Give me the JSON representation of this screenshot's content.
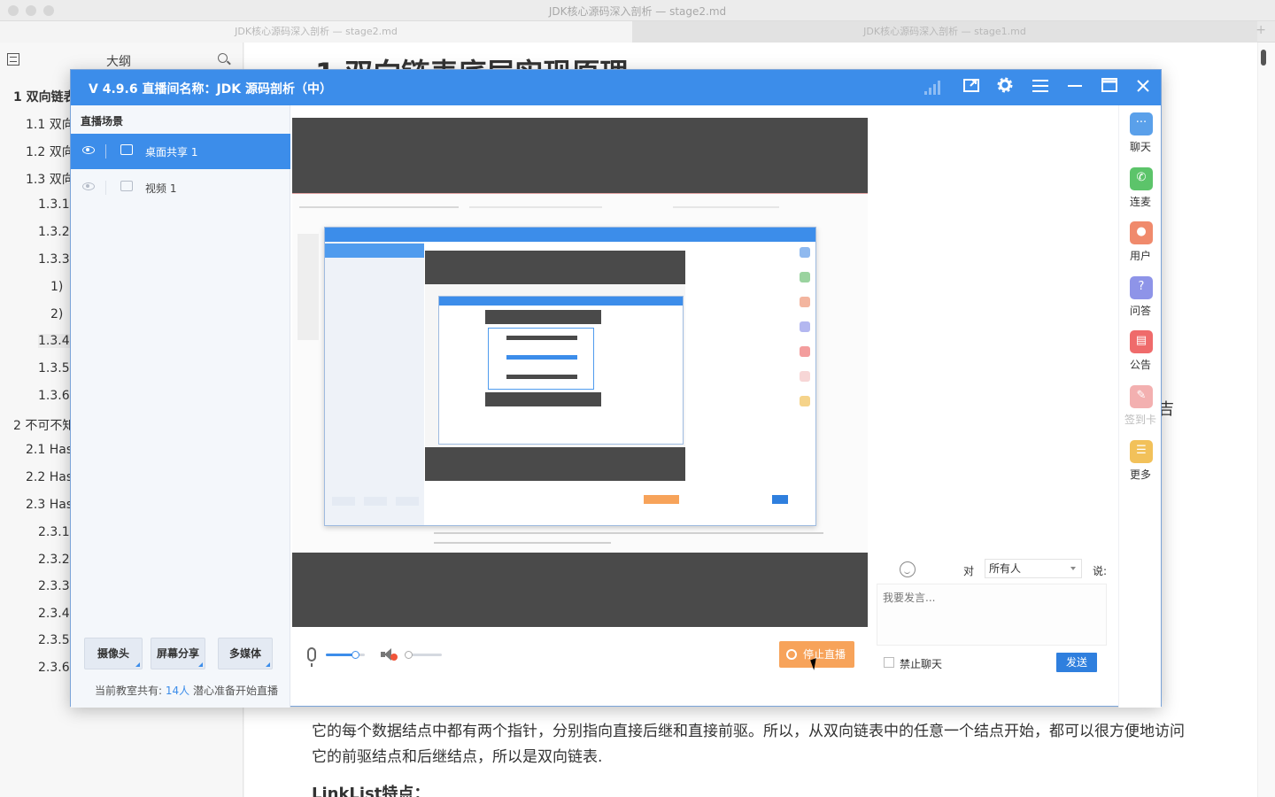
{
  "editor": {
    "window_title": "JDK核心源码深入剖析 — stage2.md",
    "tabs": [
      {
        "label": "JDK核心源码深入剖析 — stage2.md"
      },
      {
        "label": "JDK核心源码深入剖析 — stage1.md"
      }
    ],
    "outline_title": "大纲",
    "outline_items": [
      {
        "label": "1 双向链表"
      },
      {
        "label": "1.1 双向"
      },
      {
        "label": "1.2 双向"
      },
      {
        "label": "1.3 双向"
      },
      {
        "label": "1.3.1"
      },
      {
        "label": "1.3.2"
      },
      {
        "label": "1.3.3"
      },
      {
        "label": "1)"
      },
      {
        "label": "2)"
      },
      {
        "label": "1.3.4"
      },
      {
        "label": "1.3.5"
      },
      {
        "label": "1.3.6"
      },
      {
        "label": "2 不可不知"
      },
      {
        "label": "2.1 Has"
      },
      {
        "label": "2.2 Has"
      },
      {
        "label": "2.3 Has"
      },
      {
        "label": "2.3.1"
      },
      {
        "label": "2.3.2"
      },
      {
        "label": "2.3.3"
      },
      {
        "label": "2.3.4"
      },
      {
        "label": "2.3.5"
      },
      {
        "label": "2.3.6"
      }
    ],
    "heading": "1 双向链表底层实现原理",
    "paragraph": "它的每个数据结点中都有两个指针，分别指向直接后继和直接前驱。所以，从双向链表中的任意一个结点开始，都可以很方便地访问它的前驱结点和后继结点，所以是双向链表.",
    "subheading": "LinkList特点：",
    "edge_fragment": "吉"
  },
  "live": {
    "title": "V 4.9.6  直播间名称：JDK 源码剖析（中）",
    "scene_header": "直播场景",
    "scenes": [
      {
        "label": "桌面共享 1",
        "active": true
      },
      {
        "label": "视频 1",
        "active": false
      }
    ],
    "buttons": {
      "camera": "摄像头",
      "screen_share": "屏幕分享",
      "multimedia": "多媒体",
      "stop_live": "停止直播",
      "send": "发送"
    },
    "status": {
      "prefix": "当前教室共有:",
      "count": "14人",
      "suffix": "潜心准备开始直播"
    },
    "audio": {
      "mic_level": 0.75,
      "speaker_level": 0.1
    },
    "chat": {
      "to_label": "对",
      "recipient": "所有人",
      "say_label": "说:",
      "placeholder": "我要发言...",
      "ban_label": "禁止聊天"
    },
    "rail": [
      {
        "label": "聊天",
        "icon": "chat-icon",
        "color": "#5aa0ea"
      },
      {
        "label": "连麦",
        "icon": "phone-icon",
        "color": "#5cc46a"
      },
      {
        "label": "用户",
        "icon": "user-icon",
        "color": "#f08a6c"
      },
      {
        "label": "问答",
        "icon": "question-icon",
        "color": "#8e94e8"
      },
      {
        "label": "公告",
        "icon": "notice-icon",
        "color": "#ef6b6b"
      },
      {
        "label": "签到卡",
        "icon": "signin-icon",
        "color": "#f3b0b0"
      },
      {
        "label": "更多",
        "icon": "more-icon",
        "color": "#f2c15a"
      }
    ]
  },
  "colors": {
    "brand_blue": "#3c8dea",
    "stop_orange": "#f7a35a",
    "send_blue": "#2f7fde"
  }
}
